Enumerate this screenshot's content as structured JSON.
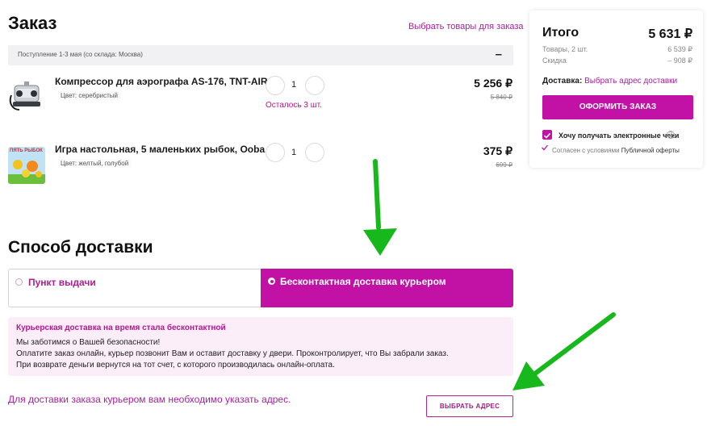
{
  "order": {
    "title": "Заказ",
    "choose_goods_link": "Выбрать товары для заказа",
    "shipment_info": "Поступление 1-3 мая (со склада: Москва)",
    "collapse_symbol": "–",
    "items": [
      {
        "name": "Компрессор для аэрографа AS-176, TNT-AIR",
        "attr": "Цвет: серебристый",
        "quantity": "1",
        "remaining": "Осталось 3 шт.",
        "price": "5 256 ₽",
        "old_price": "5 840 ₽"
      },
      {
        "name": "Игра настольная, 5 маленьких рыбок, Ooba",
        "attr": "Цвет: желтый, голубой",
        "quantity": "1",
        "price": "375 ₽",
        "old_price": "699 ₽",
        "image_text": "ПЯТЬ РЫБОК"
      }
    ]
  },
  "delivery": {
    "title": "Способ доставки",
    "options": [
      {
        "label": "Пункт выдачи"
      },
      {
        "label": "Бесконтактная доставка курьером"
      }
    ],
    "info": {
      "title": "Курьерская доставка на время стала бесконтактной",
      "lines": [
        "Мы заботимся о Вашей безопасности!",
        "Оплатите заказ онлайн, курьер позвонит Вам и оставит доставку у двери. Проконтролирует, что Вы забрали заказ.",
        "При возврате деньги вернутся на тот счет, с которого производилась онлайн-оплата."
      ]
    },
    "address_note": "Для доставки заказа курьером вам необходимо указать адрес.",
    "address_button": "ВЫБРАТЬ АДРЕС"
  },
  "summary": {
    "title": "Итого",
    "total": "5 631 ₽",
    "goods_label": "Товары, 2 шт.",
    "goods_value": "6 539 ₽",
    "discount_label": "Скидка",
    "discount_value": "– 908 ₽",
    "delivery_label": "Доставка:",
    "delivery_link": "Выбрать адрес доставки",
    "checkout_button": "ОФОРМИТЬ ЗАКАЗ",
    "receipt_label": "Хочу получать электронные чеки",
    "agree_text": "Согласен с условиями",
    "agree_link": "Публичной оферты"
  },
  "colors": {
    "accent": "#c212a6",
    "link": "#a81ea0",
    "arrow": "#16b81b"
  },
  "icons": [
    "minus-icon",
    "radio-icon",
    "check-icon",
    "help-icon",
    "arrow-icon"
  ]
}
